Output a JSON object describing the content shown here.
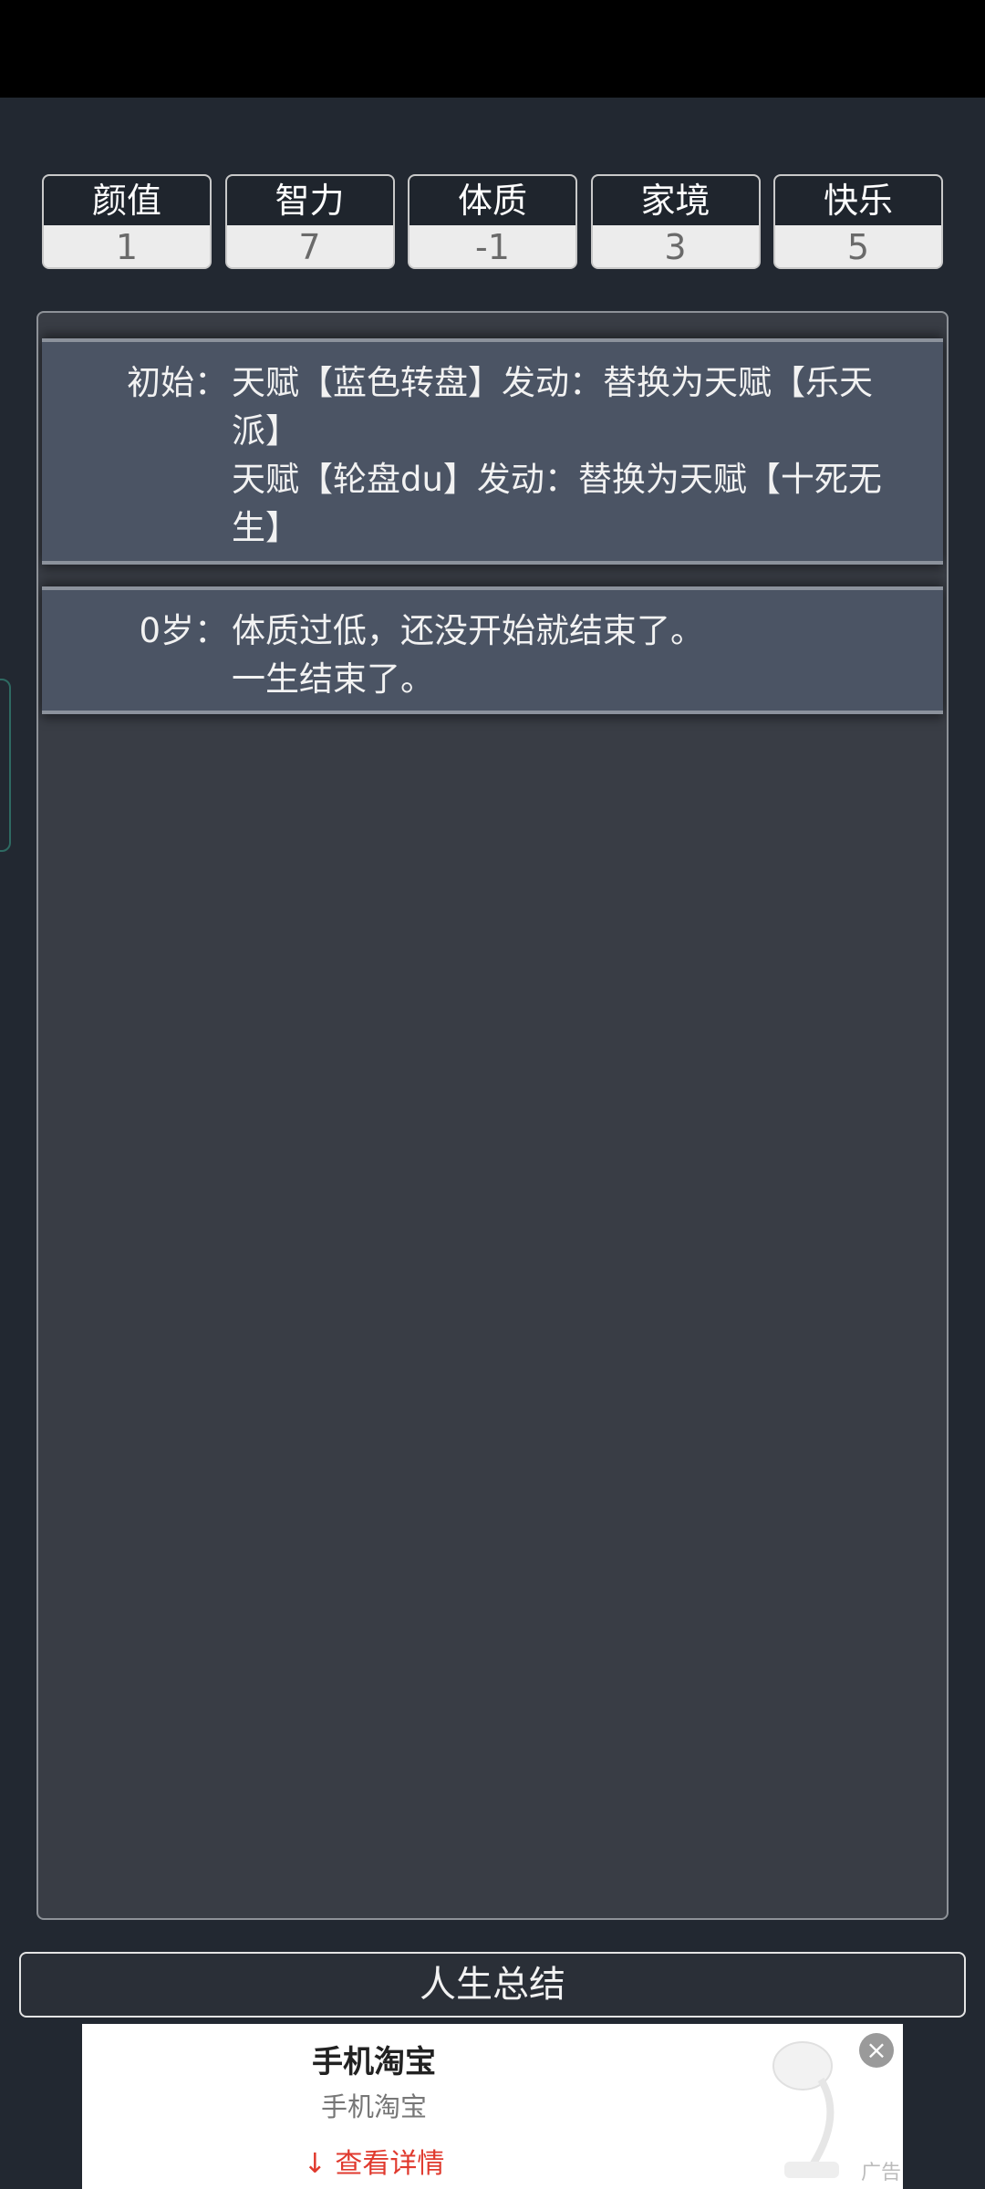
{
  "stats": [
    {
      "label": "颜值",
      "value": "1"
    },
    {
      "label": "智力",
      "value": "7"
    },
    {
      "label": "体质",
      "value": "-1"
    },
    {
      "label": "家境",
      "value": "3"
    },
    {
      "label": "快乐",
      "value": "5"
    }
  ],
  "log": [
    {
      "age": "初始：",
      "lines": [
        "天赋【蓝色转盘】发动：替换为天赋【乐天派】",
        "天赋【轮盘du】发动：替换为天赋【十死无生】"
      ]
    },
    {
      "age": "0岁：",
      "lines": [
        "体质过低，还没开始就结束了。",
        "一生结束了。"
      ]
    }
  ],
  "summary_button": "人生总结",
  "ad": {
    "title": "手机淘宝",
    "subtitle": "手机淘宝",
    "cta": "查看详情",
    "badge": "广告",
    "close_icon": "close-icon",
    "download_icon": "download-arrow-icon"
  }
}
